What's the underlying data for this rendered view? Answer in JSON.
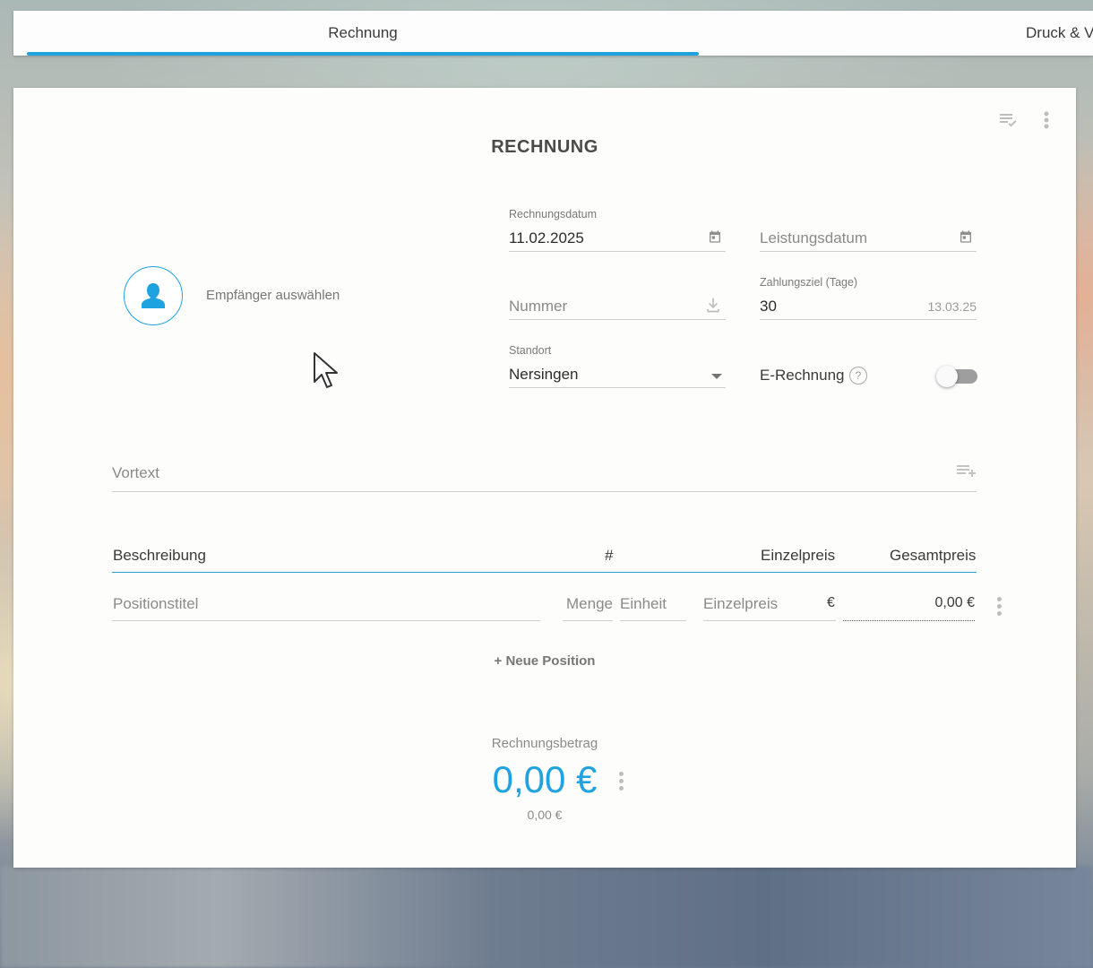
{
  "tabs": [
    {
      "label": "Rechnung",
      "active": true
    },
    {
      "label": "Druck & Ve",
      "active": false
    }
  ],
  "document": {
    "title": "RECHNUNG",
    "icons": {
      "checklist": "playlist-check-icon",
      "more": "more-vert-icon"
    }
  },
  "recipient": {
    "placeholder": "Empfänger auswählen"
  },
  "fields": {
    "rechnungsdatum": {
      "label": "Rechnungsdatum",
      "value": "11.02.2025"
    },
    "leistungsdatum": {
      "placeholder": "Leistungsdatum"
    },
    "nummer": {
      "placeholder": "Nummer"
    },
    "zahlungsziel": {
      "label": "Zahlungsziel (Tage)",
      "value": "30",
      "due_date": "13.03.25"
    },
    "standort": {
      "label": "Standort",
      "value": "Nersingen"
    },
    "e_rechnung": {
      "label": "E-Rechnung",
      "help": "?",
      "enabled": false
    }
  },
  "vortext": {
    "placeholder": "Vortext"
  },
  "table": {
    "headers": {
      "beschreibung": "Beschreibung",
      "number": "#",
      "einzelpreis": "Einzelpreis",
      "gesamtpreis": "Gesamtpreis"
    },
    "row": {
      "positionstitel": "Positionstitel",
      "menge": "Menge",
      "einheit": "Einheit",
      "einzelpreis": "Einzelpreis",
      "currency": "€",
      "total": "0,00 €"
    },
    "add_label": "+ Neue Position"
  },
  "summary": {
    "label": "Rechnungsbetrag",
    "amount": "0,00 €",
    "sub_amount": "0,00 €"
  },
  "colors": {
    "accent": "#1fa3e0",
    "text": "#3a3a3a",
    "muted": "#8a8a8a"
  }
}
